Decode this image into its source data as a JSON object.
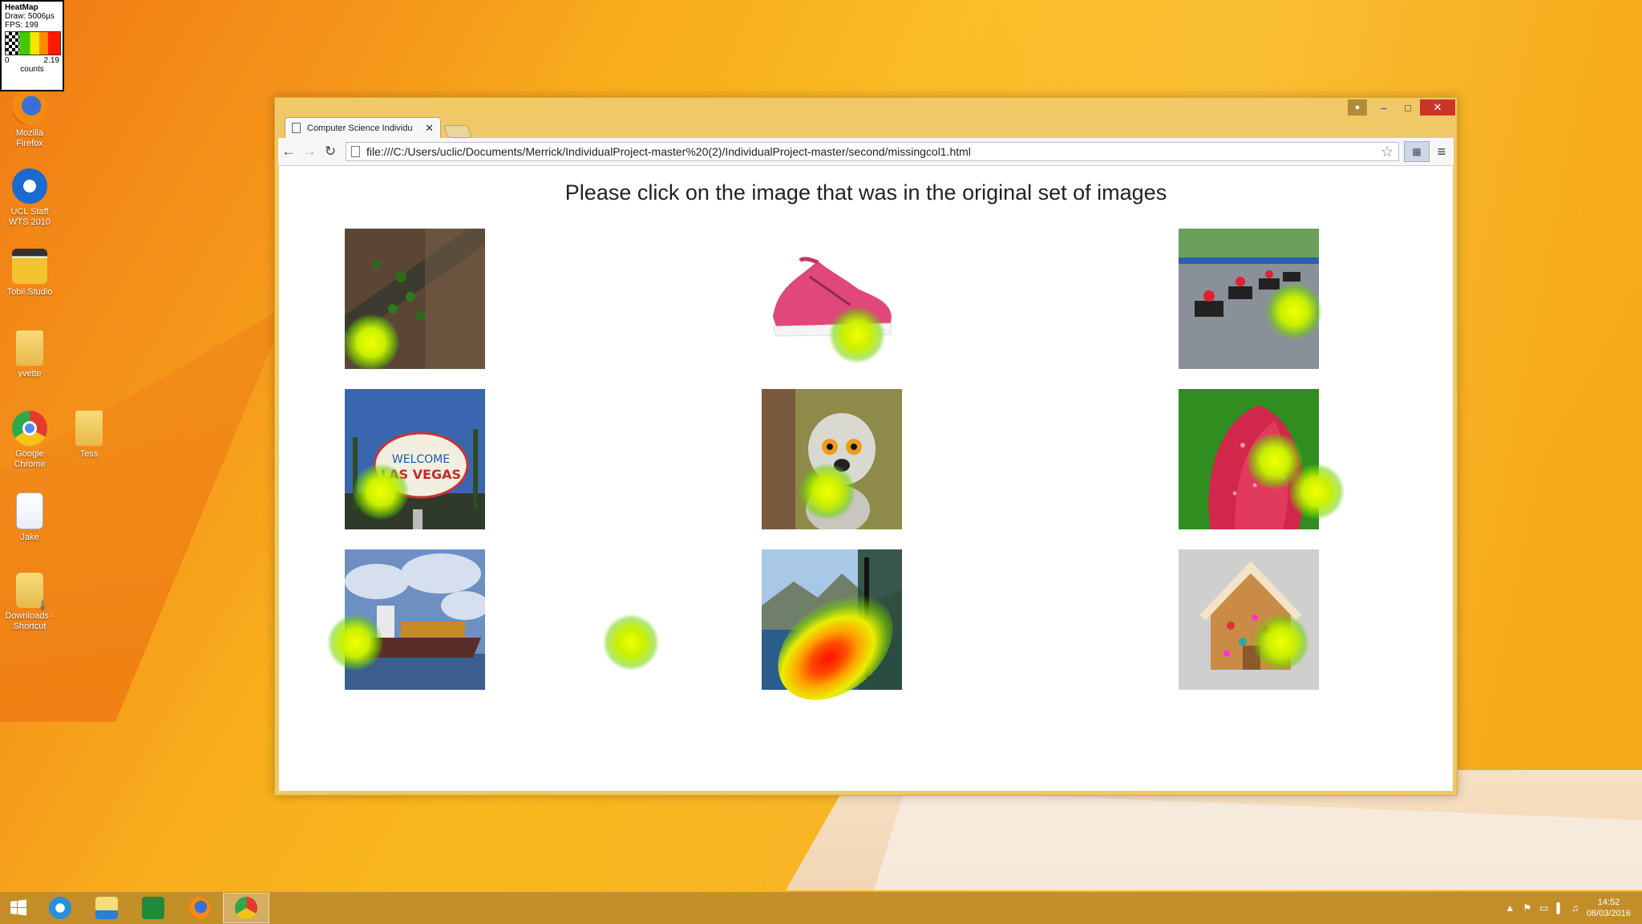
{
  "heatmap_legend": {
    "title": "HeatMap",
    "draw": "Draw: 5006µs",
    "fps": "FPS: 199",
    "min": "0",
    "max": "2.19",
    "unit": "counts"
  },
  "desktop_icons": [
    {
      "label": "Mozilla\nFirefox",
      "icon": "firefox-icon"
    },
    {
      "label": "UCL Staff\nWTS 2010",
      "icon": "ucl-wts-icon"
    },
    {
      "label": "Tobii Studio",
      "icon": "tobii-studio-icon"
    },
    {
      "label": "yvette",
      "icon": "folder-icon"
    },
    {
      "label": "Google\nChrome",
      "icon": "chrome-icon"
    },
    {
      "label": "Tess",
      "icon": "folder-icon"
    },
    {
      "label": "Jake",
      "icon": "document-icon"
    },
    {
      "label": "Downloads -\nShortcut",
      "icon": "downloads-shortcut-icon"
    }
  ],
  "browser": {
    "tab_title": "Computer Science Individu",
    "url": "file:///C:/Users/uclic/Documents/Merrick/IndividualProject-master%20(2)/IndividualProject-master/second/missingcol1.html",
    "page": {
      "heading": "Please click on the image that was in the original set of images",
      "images": [
        {
          "subject": "ladybirds on soil"
        },
        {
          "subject": "pink running shoe"
        },
        {
          "subject": "go-kart race"
        },
        {
          "subject": "Las Vegas welcome sign"
        },
        {
          "subject": "lemur"
        },
        {
          "subject": "red tulip with water drops"
        },
        {
          "subject": "cargo ship"
        },
        {
          "subject": "lake and mountains"
        },
        {
          "subject": "gingerbread house"
        }
      ]
    }
  },
  "taskbar": {
    "items": [
      "start-icon",
      "internet-explorer-icon",
      "file-explorer-icon",
      "store-icon",
      "firefox-icon",
      "chrome-icon"
    ],
    "active": "chrome-icon",
    "time": "14:52",
    "date": "08/03/2016"
  },
  "colors": {
    "desktop_accent": "#f9b81e",
    "window_frame": "#f0c865",
    "close_button": "#c8362a",
    "heat_hot": "#ff1200",
    "heat_mid": "#e8ee00",
    "heat_cool": "#6ed200"
  }
}
